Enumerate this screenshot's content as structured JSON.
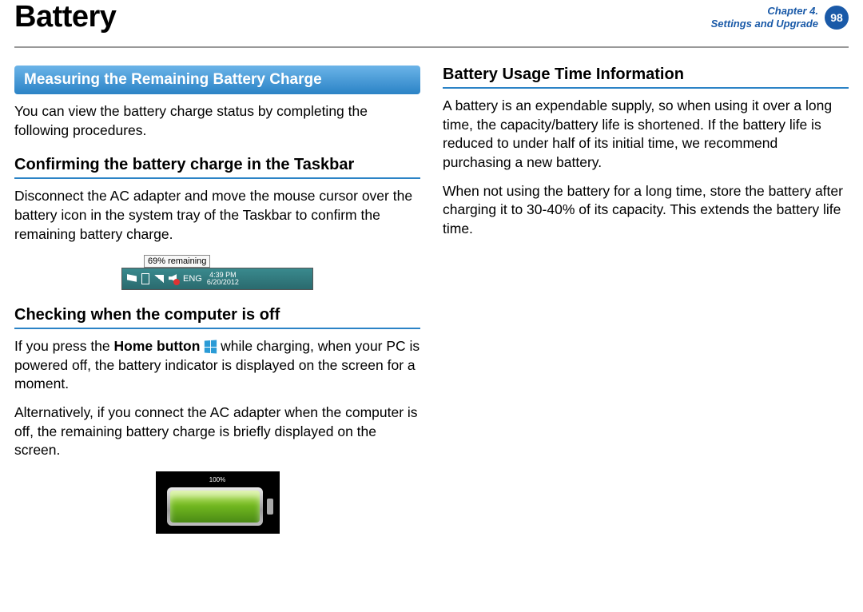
{
  "header": {
    "title": "Battery",
    "chapter_line1": "Chapter 4.",
    "chapter_line2": "Settings and Upgrade",
    "page_number": "98"
  },
  "left": {
    "banner": "Measuring the Remaining Battery Charge",
    "intro": "You can view the battery charge status by completing the following procedures.",
    "sub1": "Confirming the battery charge in the Taskbar",
    "p1": "Disconnect the AC adapter and move the mouse cursor over the battery icon in the system tray of the Taskbar to confirm the remaining battery charge.",
    "taskbar": {
      "tooltip": "69% remaining",
      "lang": "ENG",
      "time": "4:39 PM",
      "date": "6/20/2012"
    },
    "sub2": "Checking when the computer is off",
    "p2a": "If you press the ",
    "p2b_bold": "Home button",
    "p2c": " while charging, when your PC is powered off, the battery indicator is displayed  on the screen for a moment.",
    "p3": "Alternatively, if you connect the AC adapter when the computer is off, the remaining battery charge is briefly displayed on the screen.",
    "batt_pct": "100%"
  },
  "right": {
    "sub1": "Battery Usage Time Information",
    "p1": "A battery is an expendable supply, so when using it over a long time, the capacity/battery life is shortened. If the battery life is reduced to under half of its initial time, we recommend purchasing a new battery.",
    "p2": "When not using the battery for a long time, store the battery after charging it to 30-40% of its capacity. This extends the battery life time."
  }
}
